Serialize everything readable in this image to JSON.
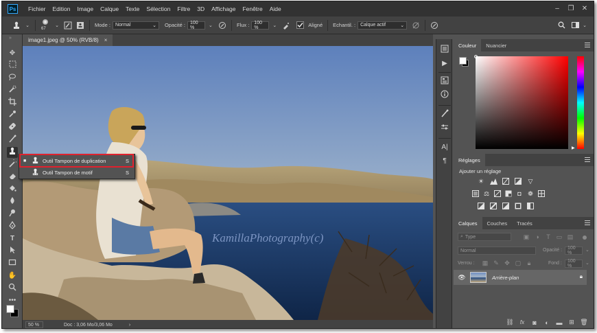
{
  "app": {
    "logo": "Ps"
  },
  "menu": [
    "Fichier",
    "Edition",
    "Image",
    "Calque",
    "Texte",
    "Sélection",
    "Filtre",
    "3D",
    "Affichage",
    "Fenêtre",
    "Aide"
  ],
  "window_controls": [
    "minimize-icon",
    "restore-icon",
    "close-icon"
  ],
  "options_bar": {
    "brush_size": "67",
    "mode_label": "Mode :",
    "mode_value": "Normal",
    "opacity_label": "Opacité :",
    "opacity_value": "100 %",
    "flux_label": "Flux :",
    "flux_value": "100 %",
    "aligned_label": "Aligné",
    "aligned_checked": true,
    "sample_label": "Echantil. :",
    "sample_value": "Calque actif"
  },
  "document": {
    "tab_title": "image1.jpeg @ 50% (RVB/8)",
    "watermark": "KamillaPhotography(c)"
  },
  "status_bar": {
    "zoom": "50 %",
    "doc": "Doc : 3,06 Mo/3,06 Mo"
  },
  "tool_flyout": {
    "items": [
      {
        "label": "Outil Tampon de duplication",
        "shortcut": "S",
        "selected": true
      },
      {
        "label": "Outil Tampon de motif",
        "shortcut": "S",
        "selected": false
      }
    ]
  },
  "colors": {
    "accent": "#31a8ff",
    "highlight_border": "#e0212d",
    "foreground": "#ffffff",
    "background": "#000000"
  },
  "panels": {
    "color_tabs": [
      "Couleur",
      "Nuancier"
    ],
    "adjustments_tab": "Réglages",
    "adjustments_title": "Ajouter un réglage",
    "layers_tabs": [
      "Calques",
      "Couches",
      "Tracés"
    ],
    "layers": {
      "filter_placeholder": "Type",
      "blend_mode": "Normal",
      "opacity_label": "Opacité :",
      "opacity_value": "100 %",
      "lock_label": "Verrou :",
      "fill_label": "Fond :",
      "fill_value": "100 %",
      "items": [
        {
          "name": "Arrière-plan",
          "visible": true,
          "locked": true
        }
      ]
    }
  }
}
